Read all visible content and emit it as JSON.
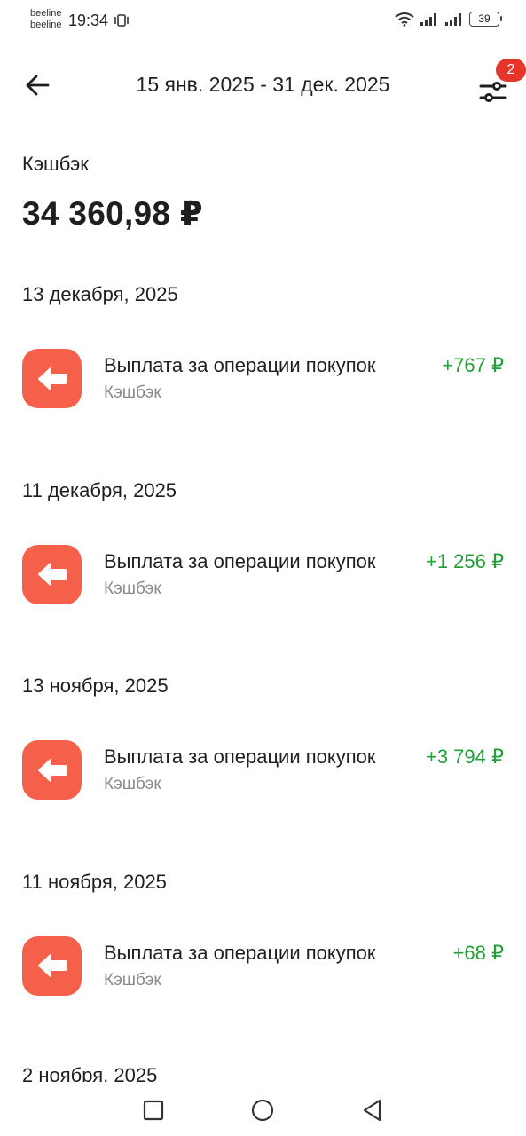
{
  "status_bar": {
    "carrier_1": "beeline",
    "carrier_2": "beeline",
    "time": "19:34",
    "battery": "39"
  },
  "header": {
    "period": "15 янв. 2025 - 31 дек. 2025",
    "filter_count": "2"
  },
  "summary": {
    "label": "Кэшбэк",
    "amount": "34 360,98 ₽"
  },
  "operations": [
    {
      "date": "13 декабря, 2025",
      "title": "Выплата за операции покупок",
      "subtitle": "Кэшбэк",
      "amount": "+767 ₽"
    },
    {
      "date": "11 декабря, 2025",
      "title": "Выплата за операции покупок",
      "subtitle": "Кэшбэк",
      "amount": "+1 256 ₽"
    },
    {
      "date": "13 ноября, 2025",
      "title": "Выплата за операции покупок",
      "subtitle": "Кэшбэк",
      "amount": "+3 794 ₽"
    },
    {
      "date": "11 ноября, 2025",
      "title": "Выплата за операции покупок",
      "subtitle": "Кэшбэк",
      "amount": "+68 ₽"
    }
  ],
  "next_date": "2 ноября, 2025",
  "colors": {
    "accent_icon": "#f4604a",
    "positive_amount": "#21a038",
    "badge": "#e8352b"
  },
  "icons": {
    "back": "arrow-left-icon",
    "filter": "sliders-icon",
    "operation": "arrow-left-in-square-icon",
    "nav_recent": "square-icon",
    "nav_home": "circle-icon",
    "nav_back": "triangle-back-icon"
  }
}
